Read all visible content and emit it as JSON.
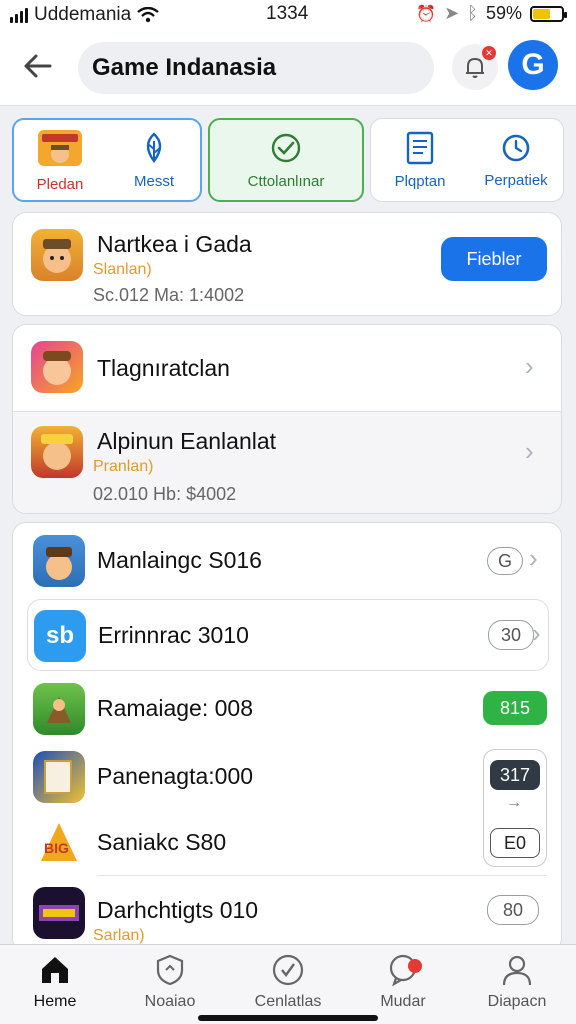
{
  "status_bar": {
    "carrier": "Uddemania",
    "time": "1334",
    "battery": "59%",
    "battery_level": 0.59
  },
  "header": {
    "back_icon": "arrow-left-icon",
    "title": "Game Indanasia",
    "notif_icon": "bell-icon",
    "profile_icon": "g-logo-icon"
  },
  "tabs": [
    {
      "label": "Pledan",
      "icon": "game-art-icon"
    },
    {
      "label": "Messt",
      "icon": "leaf-icon"
    },
    {
      "label": "Cttolanlınar",
      "icon": "check-circle-icon"
    },
    {
      "label": "Plqptan",
      "icon": "document-icon"
    },
    {
      "label": "Perpatiek",
      "icon": "clock-icon"
    }
  ],
  "featured": {
    "title": "Nartkea i Gada",
    "sub": "Slanlan)",
    "meta": "Sc.012 Ma: 1:4002",
    "button": "Fiebler"
  },
  "group2": [
    {
      "title": "Tlagnıratclan"
    },
    {
      "title": "Alpinun Eanlanlat",
      "sub": "Pranlan)",
      "meta": "02.010 Hb: $4002"
    }
  ],
  "list": [
    {
      "title": "Manlaingc S016",
      "badge": "G"
    },
    {
      "title": "Errinnrac 3010",
      "badge": "30",
      "icon_text": "sb"
    },
    {
      "title": "Ramaiage: 008",
      "badge": "815"
    },
    {
      "title": "Panenagta:000",
      "badge": "317"
    },
    {
      "title": "Saniakc S80",
      "badge": "E0"
    },
    {
      "title": "Darhchtigts 010",
      "badge": "80",
      "sub": "Sarlan)"
    }
  ],
  "bottom_nav": [
    {
      "label": "Heme",
      "icon": "home-icon"
    },
    {
      "label": "Noaiao",
      "icon": "shield-icon"
    },
    {
      "label": "Cenlatlas",
      "icon": "check-circle-icon"
    },
    {
      "label": "Mudar",
      "icon": "chat-bubble-icon"
    },
    {
      "label": "Diapacn",
      "icon": "person-icon"
    }
  ],
  "colors": {
    "accent_blue": "#1a73e8",
    "accent_green": "#4caf50",
    "badge_red": "#e53935"
  }
}
